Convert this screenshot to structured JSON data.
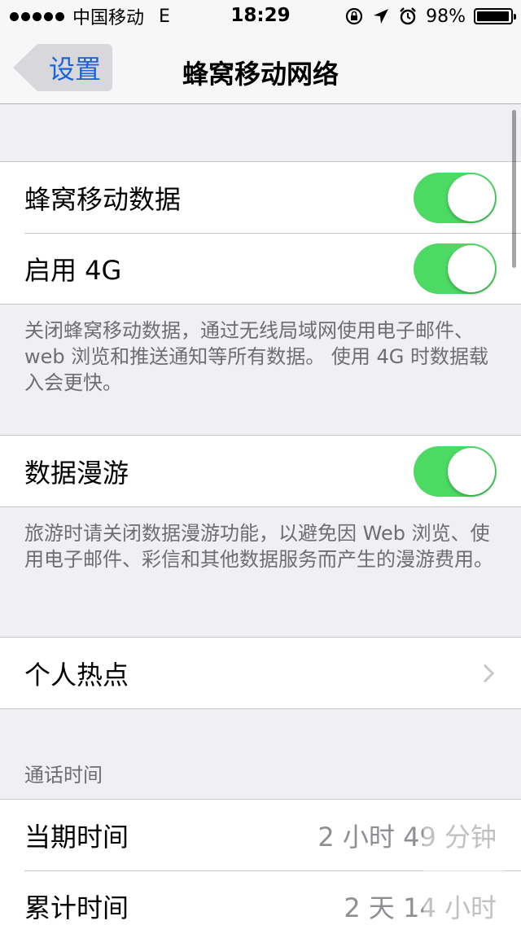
{
  "status_bar": {
    "carrier": "中国移动",
    "network": "E",
    "time": "18:29",
    "icons": [
      "rotation-lock-icon",
      "location-icon",
      "alarm-icon"
    ],
    "battery_percent": "98%",
    "battery_level": 0.98
  },
  "nav": {
    "back_label": "设置",
    "title": "蜂窝移动网络"
  },
  "cellular": {
    "cellular_data_label": "蜂窝移动数据",
    "cellular_data_on": true,
    "enable_4g_label": "启用 4G",
    "enable_4g_on": true,
    "note": "关闭蜂窝移动数据，通过无线局域网使用电子邮件、web 浏览和推送通知等所有数据。 使用 4G 时数据载入会更快。"
  },
  "roaming": {
    "label": "数据漫游",
    "on": true,
    "note": "旅游时请关闭数据漫游功能，以避免因 Web 浏览、使用电子邮件、彩信和其他数据服务而产生的漫游费用。"
  },
  "hotspot": {
    "label": "个人热点"
  },
  "call_time": {
    "header": "通话时间",
    "rows": [
      {
        "label": "当期时间",
        "value": "2 小时 49 分钟"
      },
      {
        "label": "累计时间",
        "value": "2 天 14 小时"
      }
    ]
  },
  "colors": {
    "toggle_on": "#4cd964",
    "tint": "#1a63d6",
    "background": "#efeff4"
  }
}
